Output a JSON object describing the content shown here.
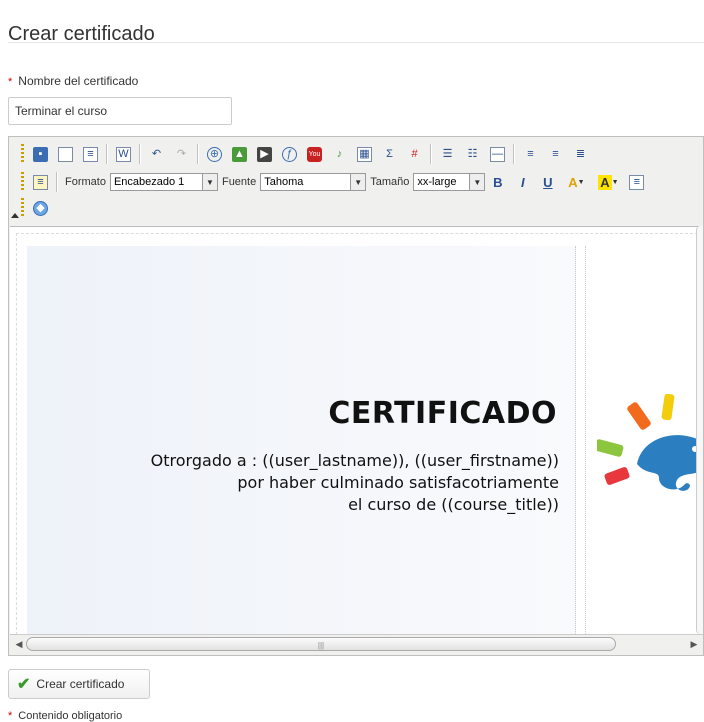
{
  "page": {
    "title": "Crear certificado"
  },
  "form": {
    "name_label": "Nombre del certificado",
    "required_mark": "*",
    "name_value": "Terminar el curso",
    "submit_label": "Crear certificado",
    "required_note": "Contenido obligatorio"
  },
  "toolbar": {
    "row1_icons": [
      "save-icon",
      "new-document-icon",
      "templates-icon",
      "paste-from-word-icon",
      "undo-icon",
      "redo-icon",
      "insert-link-icon",
      "insert-image-icon",
      "insert-video-icon",
      "insert-flash-icon",
      "insert-youtube-icon",
      "insert-audio-icon",
      "insert-table-icon",
      "insert-formula-icon",
      "remove-format-icon",
      "bulleted-list-icon",
      "numbered-list-icon",
      "horizontal-rule-icon",
      "align-left-icon",
      "align-center-icon",
      "justify-icon"
    ],
    "format_label": "Formato",
    "format_value": "Encabezado 1",
    "font_label": "Fuente",
    "font_value": "Tahoma",
    "size_label": "Tamaño",
    "size_value": "xx-large",
    "bold": "B",
    "italic": "I",
    "underline": "U",
    "text_color_glyph": "A",
    "bg_color_glyph": "A",
    "formula_glyph": "Σ"
  },
  "certificate": {
    "heading": "CERTIFICADO",
    "line1": "Otrorgado a : ((user_lastname)), ((user_firstname))",
    "line2": "por haber culminado satisfacotriamente",
    "line3": "el curso de ((course_title))"
  },
  "colors": {
    "accent_blue": "#2b4f8f",
    "check_green": "#3a9a2a",
    "required_red": "#cc0000"
  }
}
